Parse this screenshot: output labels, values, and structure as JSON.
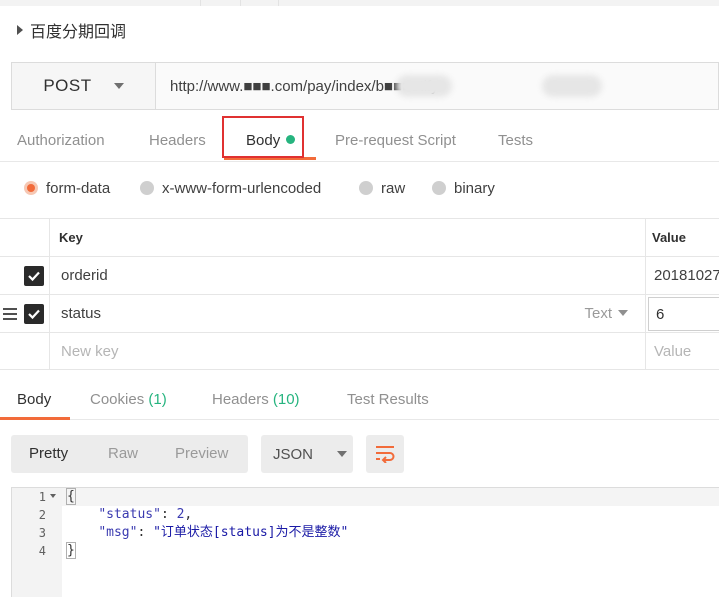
{
  "request": {
    "name": "百度分期回调",
    "method": "POST",
    "url": "http://www.■■■.com/pay/index/b■■■otify"
  },
  "request_tabs": {
    "authorization": "Authorization",
    "headers": "Headers",
    "body": "Body",
    "prerequest": "Pre-request Script",
    "tests": "Tests"
  },
  "body_modes": {
    "form_data": "form-data",
    "urlencoded": "x-www-form-urlencoded",
    "raw": "raw",
    "binary": "binary",
    "selected": "form-data"
  },
  "params_table": {
    "key_header": "Key",
    "value_header": "Value",
    "rows": [
      {
        "key": "orderid",
        "value": "20181027",
        "checked": true
      },
      {
        "key": "status",
        "value": "6",
        "type": "Text",
        "checked": true
      }
    ],
    "new_key_placeholder": "New key",
    "new_value_placeholder": "Value"
  },
  "response_tabs": {
    "body": "Body",
    "cookies": "Cookies",
    "cookies_count": "(1)",
    "headers": "Headers",
    "headers_count": "(10)",
    "test_results": "Test Results"
  },
  "view_modes": {
    "pretty": "Pretty",
    "raw": "Raw",
    "preview": "Preview",
    "format": "JSON"
  },
  "response_body": {
    "line_numbers": [
      "1",
      "2",
      "3",
      "4"
    ],
    "open_brace": "{",
    "close_brace": "}",
    "status_key": "\"status\"",
    "status_value": "2",
    "msg_key": "\"msg\"",
    "msg_value": "\"订单状态[status]为不是整数\""
  },
  "colors": {
    "accent": "#f26b3a",
    "green_dot": "#26b47f",
    "highlight_box": "#e03131"
  }
}
